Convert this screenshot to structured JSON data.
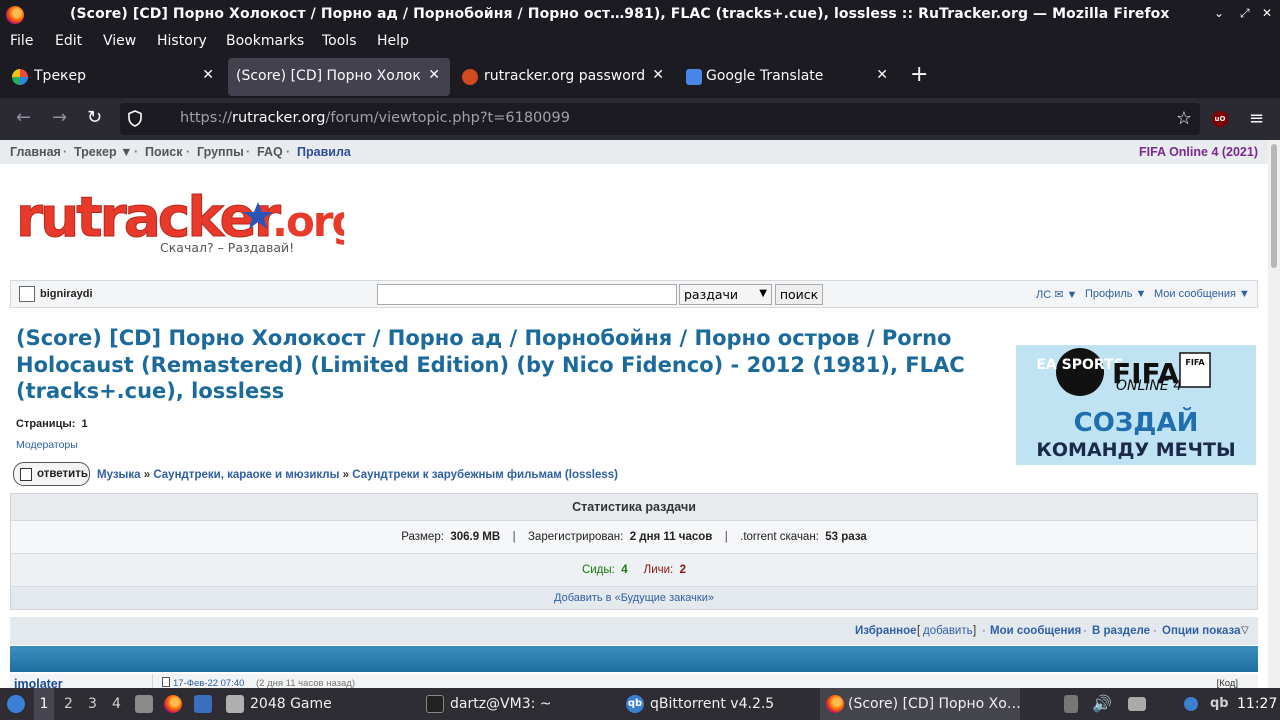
{
  "window": {
    "title": "(Score) [CD] Порно Холокост / Порно ад / Порнобойня / Порно ост…981), FLAC (tracks+.cue), lossless :: RuTracker.org — Mozilla Firefox"
  },
  "menu": [
    "File",
    "Edit",
    "View",
    "History",
    "Bookmarks",
    "Tools",
    "Help"
  ],
  "tabs": [
    {
      "label": "Трекер",
      "favicon_color": "#c0392b"
    },
    {
      "label": "(Score) [CD] Порно Холокост",
      "favicon_color": "#e04040"
    },
    {
      "label": "rutracker.org passwords",
      "favicon_color": "#d14a20"
    },
    {
      "label": "Google Translate",
      "favicon_color": "#4a86e8"
    }
  ],
  "url": {
    "prefix": "https://",
    "domain": "rutracker.org",
    "path": "/forum/viewtopic.php?t=6180099"
  },
  "site": {
    "nav": [
      "Главная",
      "Трекер ▼",
      "Поиск",
      "Группы",
      "FAQ",
      "Правила"
    ],
    "promo": "FIFA Online 4 (2021)",
    "logo_text": "rutracker.org",
    "logo_tagline": "Скачал? – Раздавай!",
    "username": "bigniraydi",
    "search_select": "раздачи",
    "search_button": "поиск",
    "user_links": [
      "ЛС ✉ ▼",
      "Профиль ▼",
      "Мои сообщения ▼"
    ]
  },
  "topic": {
    "title": "(Score) [CD] Порно Холокост / Порно ад / Порнобойня / Порно остров / Porno Holocaust (Remastered) (Limited Edition) (by Nico Fidenco) - 2012 (1981), FLAC (tracks+.cue), lossless",
    "pages_label": "Страницы:",
    "pages_value": "1",
    "moderators": "Модераторы",
    "reply_label": "ответить",
    "breadcrumbs": [
      "Музыка",
      "Саундтреки, караоке и мюзиклы",
      "Саундтреки к зарубежным фильмам (lossless)"
    ]
  },
  "ad": {
    "brand": "FIFA",
    "sub": "ONLINE 4",
    "ea": "EA SPORTS",
    "line1": "СОЗДАЙ",
    "line2": "КОМАНДУ МЕЧТЫ",
    "badge": "FIFA"
  },
  "stats": {
    "header": "Статистика раздачи",
    "size_label": "Размер:",
    "size_value": "306.9 MB",
    "registered_label": "Зарегистрирован:",
    "registered_value": "2 дня 11 часов",
    "downloaded_label": ".torrent скачан:",
    "downloaded_value": "53 раза",
    "seeds_label": "Сиды:",
    "seeds_value": "4",
    "leech_label": "Личи:",
    "leech_value": "2",
    "future_link": "Добавить в «Будущие закачки»"
  },
  "options": {
    "fav": "Избранное",
    "add": "добавить",
    "my_posts": "Мои сообщения",
    "in_section": "В разделе",
    "display_opts": "Опции показа"
  },
  "post": {
    "author": "imolater",
    "date": "17-Фев-22 07:40",
    "ago": "(2 дня 11 часов назад)",
    "code": "[Код]"
  },
  "taskbar": {
    "workspaces": [
      "1",
      "2",
      "3",
      "4"
    ],
    "tasks": [
      "2048 Game",
      "dartz@VM3: ~",
      "qBittorrent v4.2.5",
      "(Score) [CD] Порно Хо…"
    ],
    "clock": "11:27"
  }
}
